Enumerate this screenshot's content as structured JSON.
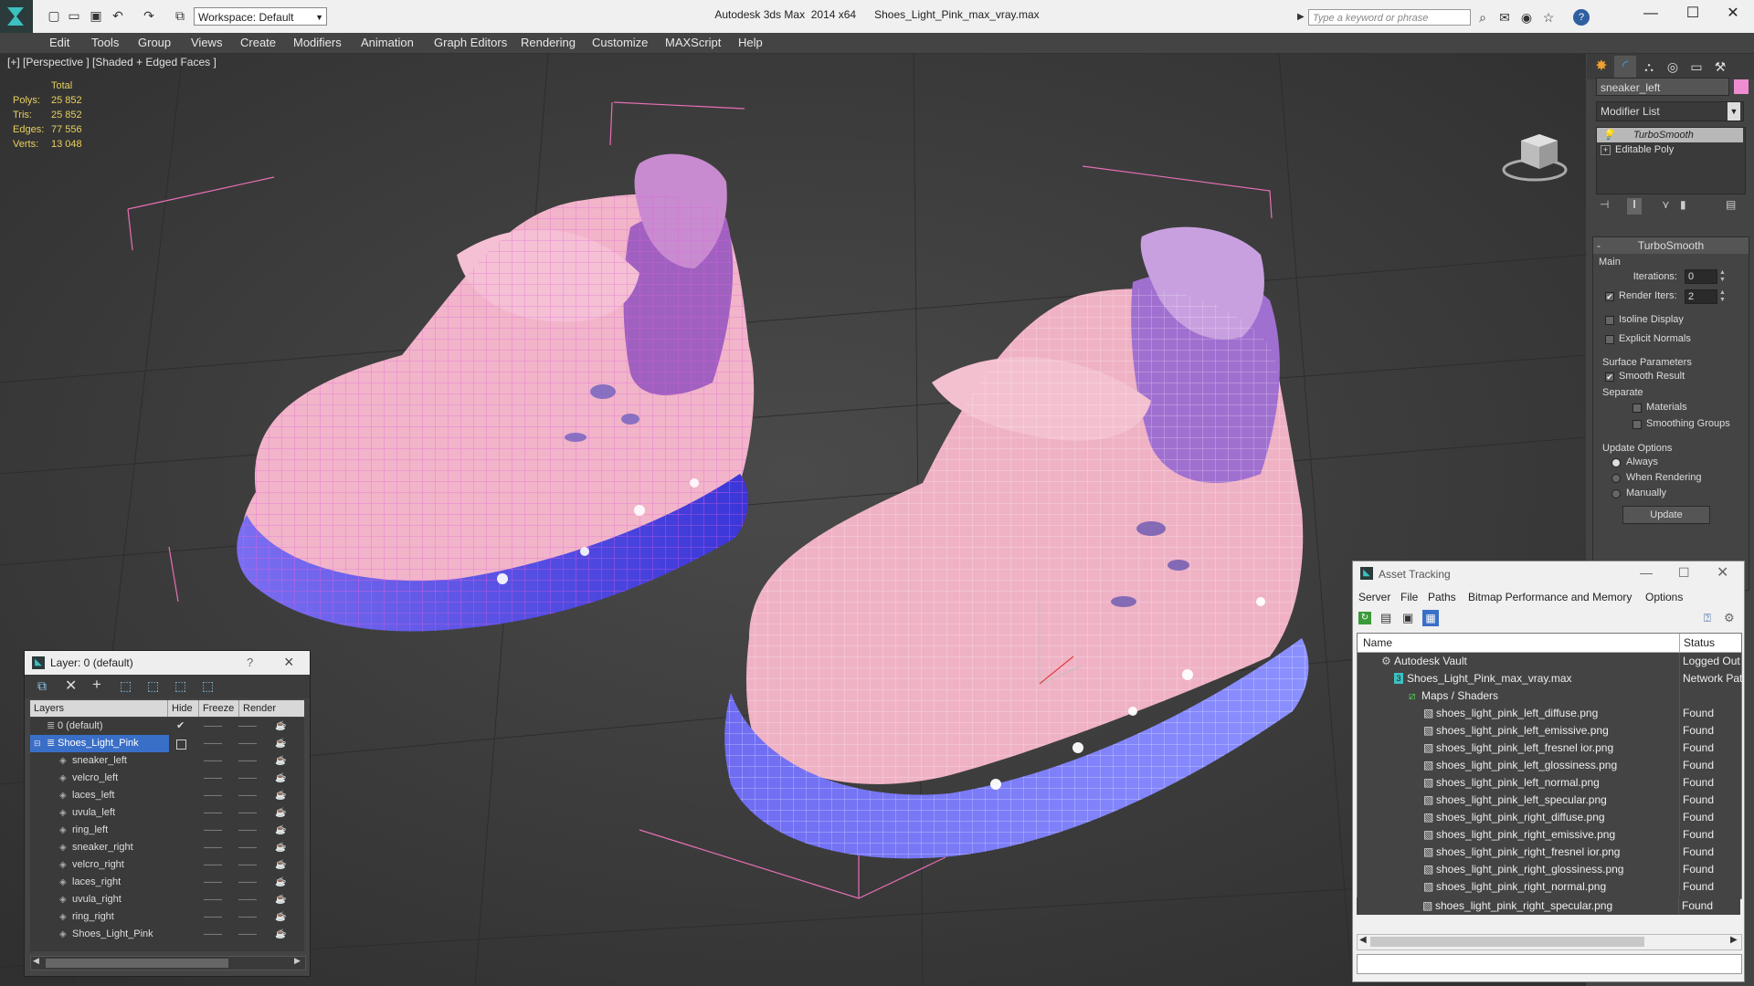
{
  "titlebar": {
    "workspace": "Workspace: Default",
    "app_title": "Autodesk 3ds Max  2014 x64      Shoes_Light_Pink_max_vray.max",
    "search_placeholder": "Type a keyword or phrase",
    "help_icon": "?"
  },
  "menubar": {
    "items": [
      "Edit",
      "Tools",
      "Group",
      "Views",
      "Create",
      "Modifiers",
      "Animation",
      "Graph Editors",
      "Rendering",
      "Customize",
      "MAXScript",
      "Help"
    ]
  },
  "viewport": {
    "label": "[+] [Perspective ] [Shaded + Edged Faces ]",
    "stats": {
      "header": "Total",
      "rows": [
        {
          "label": "Polys:",
          "value": "25 852"
        },
        {
          "label": "Tris:",
          "value": "25 852"
        },
        {
          "label": "Edges:",
          "value": "77 556"
        },
        {
          "label": "Verts:",
          "value": "13 048"
        }
      ]
    }
  },
  "command_panel": {
    "object_name": "sneaker_left",
    "object_color": "#f08cd0",
    "modifier_list": "Modifier List",
    "stack": [
      "TurboSmooth",
      "Editable Poly"
    ],
    "rollout_title": "TurboSmooth",
    "main_label": "Main",
    "iterations_label": "Iterations:",
    "iterations_value": "0",
    "render_iters_label": "Render Iters:",
    "render_iters_value": "2",
    "render_iters_checked": "✔",
    "isoline_label": "Isoline Display",
    "explicit_normals_label": "Explicit Normals",
    "surface_params_label": "Surface Parameters",
    "smooth_result_label": "Smooth Result",
    "smooth_result_checked": "✔",
    "separate_label": "Separate",
    "materials_label": "Materials",
    "smoothing_groups_label": "Smoothing Groups",
    "update_options_label": "Update Options",
    "update_always": "Always",
    "update_when_rendering": "When Rendering",
    "update_manually": "Manually",
    "update_button": "Update"
  },
  "layer_window": {
    "title": "Layer: 0 (default)",
    "help": "?",
    "close": "×",
    "headers": {
      "layers": "Layers",
      "hide": "Hide",
      "freeze": "Freeze",
      "render": "Render"
    },
    "rows": [
      {
        "name": "0 (default)",
        "check": "✔"
      },
      {
        "name": "Shoes_Light_Pink",
        "check": ""
      },
      {
        "name": "sneaker_left",
        "check": ""
      },
      {
        "name": "velcro_left",
        "check": ""
      },
      {
        "name": "laces_left",
        "check": ""
      },
      {
        "name": "uvula_left",
        "check": ""
      },
      {
        "name": "ring_left",
        "check": ""
      },
      {
        "name": "sneaker_right",
        "check": ""
      },
      {
        "name": "velcro_right",
        "check": ""
      },
      {
        "name": "laces_right",
        "check": ""
      },
      {
        "name": "uvula_right",
        "check": ""
      },
      {
        "name": "ring_right",
        "check": ""
      },
      {
        "name": "Shoes_Light_Pink",
        "check": ""
      }
    ],
    "dash": "——"
  },
  "asset_window": {
    "title": "Asset Tracking",
    "menu": [
      "Server",
      "File",
      "Paths",
      "Bitmap Performance and Memory",
      "Options"
    ],
    "headers": {
      "name": "Name",
      "status": "Status"
    },
    "rows": [
      {
        "name": "Autodesk Vault",
        "status": "Logged Out"
      },
      {
        "name": "Shoes_Light_Pink_max_vray.max",
        "status": "Network Pat"
      },
      {
        "name": "Maps / Shaders",
        "status": ""
      },
      {
        "name": "shoes_light_pink_left_diffuse.png",
        "status": "Found"
      },
      {
        "name": "shoes_light_pink_left_emissive.png",
        "status": "Found"
      },
      {
        "name": "shoes_light_pink_left_fresnel ior.png",
        "status": "Found"
      },
      {
        "name": "shoes_light_pink_left_glossiness.png",
        "status": "Found"
      },
      {
        "name": "shoes_light_pink_left_normal.png",
        "status": "Found"
      },
      {
        "name": "shoes_light_pink_left_specular.png",
        "status": "Found"
      },
      {
        "name": "shoes_light_pink_right_diffuse.png",
        "status": "Found"
      },
      {
        "name": "shoes_light_pink_right_emissive.png",
        "status": "Found"
      },
      {
        "name": "shoes_light_pink_right_fresnel ior.png",
        "status": "Found"
      },
      {
        "name": "shoes_light_pink_right_glossiness.png",
        "status": "Found"
      },
      {
        "name": "shoes_light_pink_right_normal.png",
        "status": "Found"
      },
      {
        "name": "shoes_light_pink_right_specular.png",
        "status": "Found"
      }
    ]
  }
}
